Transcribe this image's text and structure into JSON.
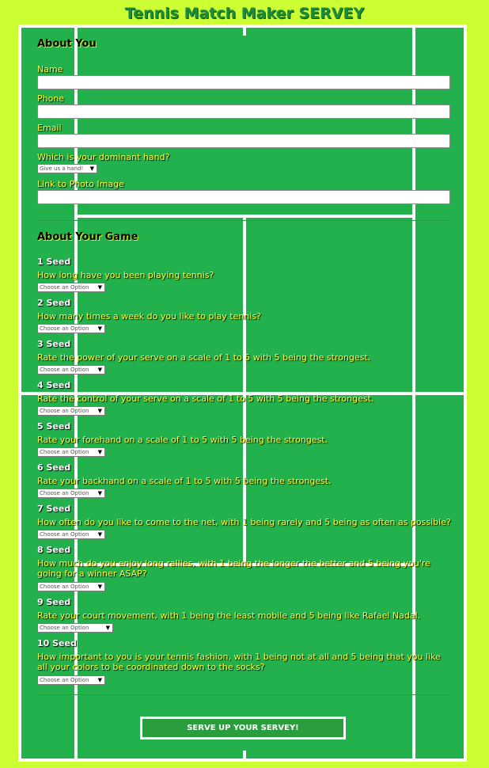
{
  "header": {
    "title": "Tennis Match Maker SERVEY"
  },
  "about_you": {
    "heading": "About You",
    "name_label": "Name",
    "phone_label": "Phone",
    "email_label": "Email",
    "hand_label": "Which is your dominant hand?",
    "hand_selected": "Give us a hand!",
    "photo_label": "Link to Photo Image"
  },
  "about_game": {
    "heading": "About Your Game",
    "questions": [
      {
        "seed": "1 Seed",
        "text": "How long have you been playing tennis?",
        "selected": "Choose an Option"
      },
      {
        "seed": "2 Seed",
        "text": "How many times a week do you like to play tennis?",
        "selected": "Choose an Option"
      },
      {
        "seed": "3 Seed",
        "text": "Rate the power of your serve on a scale of 1 to 5 with 5 being the strongest.",
        "selected": "Choose an Option"
      },
      {
        "seed": "4 Seed",
        "text": "Rate the control of your serve on a scale of 1 to 5 with 5 being the strongest.",
        "selected": "Choose an Option"
      },
      {
        "seed": "5 Seed",
        "text": "Rate your forehand on a scale of 1 to 5 with 5 being the strongest.",
        "selected": "Choose an Option"
      },
      {
        "seed": "6 Seed",
        "text": "Rate your backhand on a scale of 1 to 5 with 5 being the strongest.",
        "selected": "Choose an Option"
      },
      {
        "seed": "7 Seed",
        "text": "How often do you like to come to the net, with 1 being rarely and 5 being as often as possible?",
        "selected": "Choose an Option"
      },
      {
        "seed": "8 Seed",
        "text": "How much do you enjoy long rallies, with 1 being the longer the better and 5 being you're going for a winner ASAP?",
        "selected": "Choose an Option"
      },
      {
        "seed": "9 Seed",
        "text": "Rate your court movement, with 1 being the least mobile and 5 being like Rafael Nadal.",
        "selected": "Choose an Option"
      },
      {
        "seed": "10 Seed",
        "text": "How important to you is your tennis fashion, with 1 being not at all and 5 being that you like all your colors to be coordinated down to the socks?",
        "selected": "Choose an Option"
      }
    ]
  },
  "submit": {
    "label": "SERVE UP YOUR SERVEY!"
  }
}
